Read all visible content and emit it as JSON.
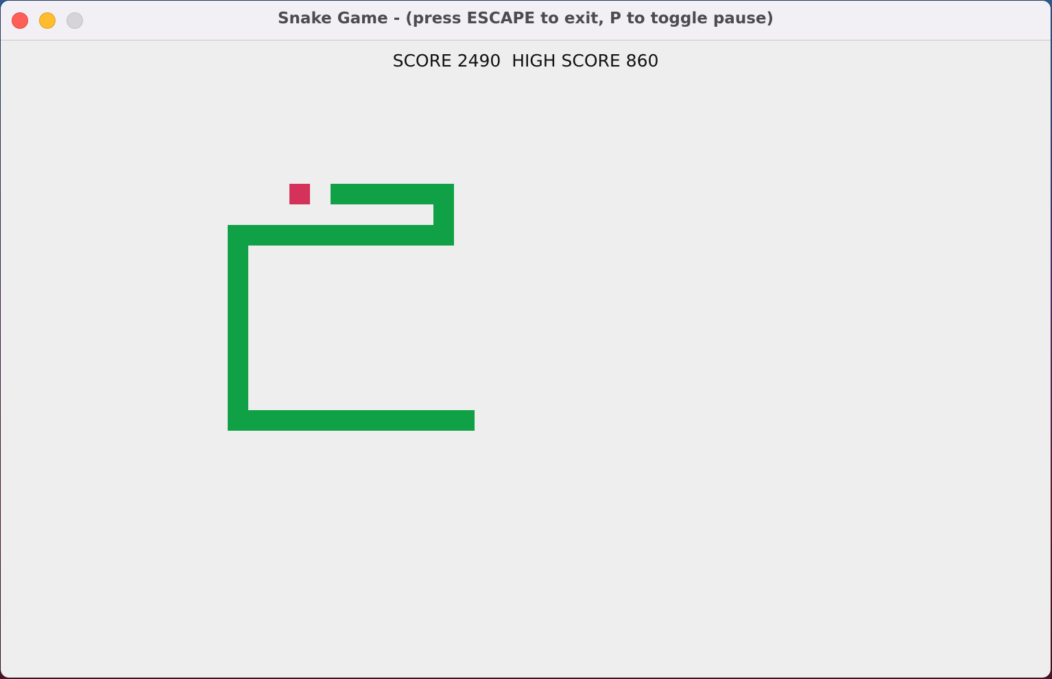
{
  "window": {
    "title": "Snake Game - (press ESCAPE to exit, P to toggle pause)"
  },
  "hud": {
    "score_label": "SCORE",
    "score": "2490",
    "high_score_label": "HIGH SCORE",
    "high_score": "860"
  },
  "game": {
    "snake_color": "#10a045",
    "food_color": "#d4325a",
    "background_color": "#eeeeee",
    "food": {
      "col": 14,
      "row": 9
    },
    "snake": [
      [
        16,
        9
      ],
      [
        17,
        9
      ],
      [
        18,
        9
      ],
      [
        19,
        9
      ],
      [
        20,
        9
      ],
      [
        21,
        9
      ],
      [
        21,
        10
      ],
      [
        21,
        11
      ],
      [
        20,
        11
      ],
      [
        19,
        11
      ],
      [
        18,
        11
      ],
      [
        17,
        11
      ],
      [
        16,
        11
      ],
      [
        15,
        11
      ],
      [
        14,
        11
      ],
      [
        13,
        11
      ],
      [
        12,
        11
      ],
      [
        11,
        11
      ],
      [
        11,
        12
      ],
      [
        11,
        13
      ],
      [
        11,
        14
      ],
      [
        11,
        15
      ],
      [
        11,
        16
      ],
      [
        11,
        17
      ],
      [
        11,
        18
      ],
      [
        11,
        19
      ],
      [
        11,
        20
      ],
      [
        12,
        20
      ],
      [
        13,
        20
      ],
      [
        14,
        20
      ],
      [
        15,
        20
      ],
      [
        16,
        20
      ],
      [
        17,
        20
      ],
      [
        18,
        20
      ],
      [
        19,
        20
      ],
      [
        20,
        20
      ],
      [
        21,
        20
      ],
      [
        22,
        20
      ]
    ]
  }
}
